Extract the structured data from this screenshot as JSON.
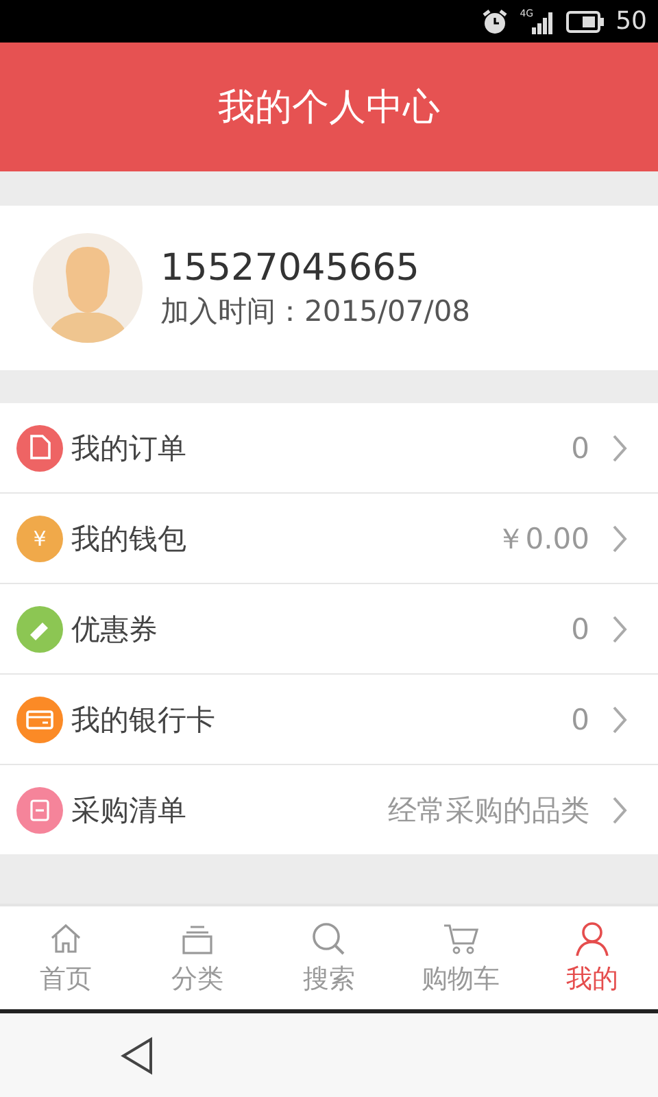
{
  "status_bar": {
    "network": "4G",
    "battery": "50"
  },
  "header": {
    "title": "我的个人中心"
  },
  "profile": {
    "phone": "15527045665",
    "joined": "加入时间：2015/07/08"
  },
  "menu": [
    {
      "kind": "order",
      "label": "我的订单",
      "value": "0",
      "color": "#ee6464"
    },
    {
      "kind": "wallet",
      "label": "我的钱包",
      "value": "￥0.00",
      "color": "#f0a94a",
      "symbol": "¥"
    },
    {
      "kind": "coupon",
      "label": "优惠券",
      "value": "0",
      "color": "#8cc653"
    },
    {
      "kind": "card",
      "label": "我的银行卡",
      "value": "0",
      "color": "#fb8a26"
    },
    {
      "kind": "list",
      "label": "采购清单",
      "value": "经常采购的品类",
      "color": "#f5849a"
    }
  ],
  "tabs": [
    {
      "kind": "home",
      "label": "首页",
      "selected": false
    },
    {
      "kind": "category",
      "label": "分类",
      "selected": false
    },
    {
      "kind": "search",
      "label": "搜索",
      "selected": false
    },
    {
      "kind": "cart",
      "label": "购物车",
      "selected": false
    },
    {
      "kind": "me",
      "label": "我的",
      "selected": true
    }
  ]
}
